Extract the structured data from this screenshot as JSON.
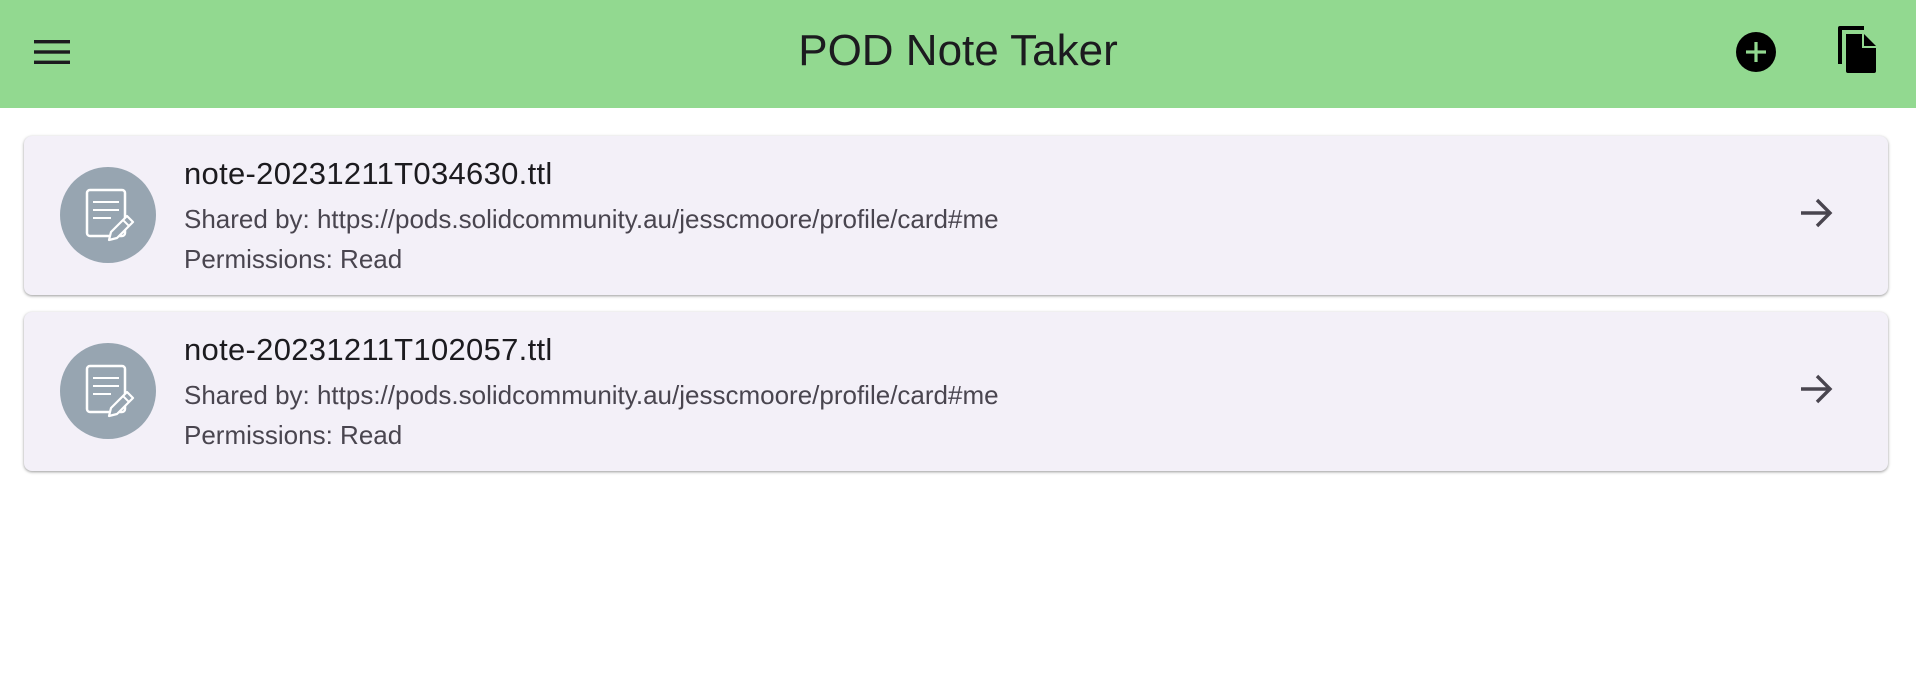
{
  "appbar": {
    "title": "POD Note Taker",
    "color": "#92d990",
    "menu_icon": "menu-icon",
    "add_icon": "add-circle-icon",
    "shared_icon": "file-copy-icon"
  },
  "notes": [
    {
      "filename": "note-20231211T034630.ttl",
      "shared_by": "Shared by: https://pods.solidcommunity.au/jesscmoore/profile/card#me",
      "permissions": "Permissions: Read",
      "icon": "note-edit-icon",
      "action_icon": "arrow-forward-icon"
    },
    {
      "filename": "note-20231211T102057.ttl",
      "shared_by": "Shared by: https://pods.solidcommunity.au/jesscmoore/profile/card#me",
      "permissions": "Permissions: Read",
      "icon": "note-edit-icon",
      "action_icon": "arrow-forward-icon"
    }
  ]
}
